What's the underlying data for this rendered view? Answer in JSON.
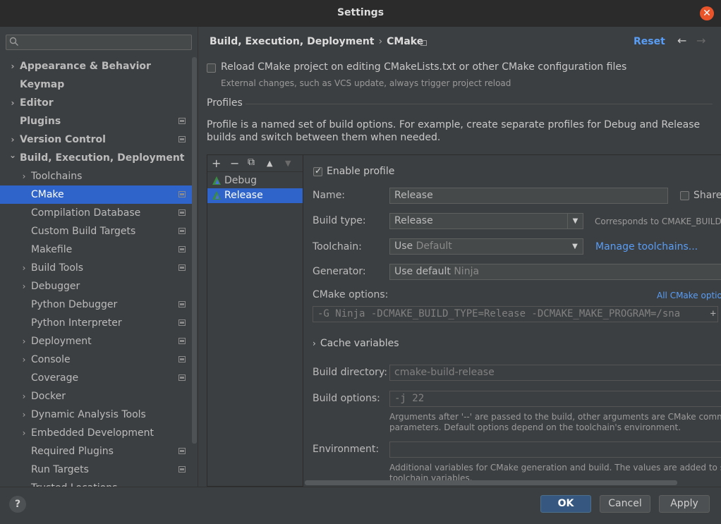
{
  "window": {
    "title": "Settings"
  },
  "sidebar": {
    "search_placeholder": "",
    "items": [
      {
        "label": "Appearance & Behavior",
        "bold": true,
        "chevron": true,
        "indent": 0,
        "proj": false
      },
      {
        "label": "Keymap",
        "bold": true,
        "chevron": false,
        "indent": 0,
        "proj": false
      },
      {
        "label": "Editor",
        "bold": true,
        "chevron": true,
        "indent": 0,
        "proj": false
      },
      {
        "label": "Plugins",
        "bold": true,
        "chevron": false,
        "indent": 0,
        "proj": true
      },
      {
        "label": "Version Control",
        "bold": true,
        "chevron": true,
        "indent": 0,
        "proj": true
      },
      {
        "label": "Build, Execution, Deployment",
        "bold": true,
        "chevron": "open",
        "indent": 0,
        "proj": false
      },
      {
        "label": "Toolchains",
        "bold": false,
        "chevron": true,
        "indent": 1,
        "proj": false
      },
      {
        "label": "CMake",
        "bold": false,
        "chevron": false,
        "indent": 1,
        "proj": true,
        "selected": true
      },
      {
        "label": "Compilation Database",
        "bold": false,
        "chevron": false,
        "indent": 1,
        "proj": true
      },
      {
        "label": "Custom Build Targets",
        "bold": false,
        "chevron": false,
        "indent": 1,
        "proj": true
      },
      {
        "label": "Makefile",
        "bold": false,
        "chevron": false,
        "indent": 1,
        "proj": true
      },
      {
        "label": "Build Tools",
        "bold": false,
        "chevron": true,
        "indent": 1,
        "proj": true
      },
      {
        "label": "Debugger",
        "bold": false,
        "chevron": true,
        "indent": 1,
        "proj": false
      },
      {
        "label": "Python Debugger",
        "bold": false,
        "chevron": false,
        "indent": 1,
        "proj": true
      },
      {
        "label": "Python Interpreter",
        "bold": false,
        "chevron": false,
        "indent": 1,
        "proj": true
      },
      {
        "label": "Deployment",
        "bold": false,
        "chevron": true,
        "indent": 1,
        "proj": true
      },
      {
        "label": "Console",
        "bold": false,
        "chevron": true,
        "indent": 1,
        "proj": true
      },
      {
        "label": "Coverage",
        "bold": false,
        "chevron": false,
        "indent": 1,
        "proj": true
      },
      {
        "label": "Docker",
        "bold": false,
        "chevron": true,
        "indent": 1,
        "proj": false
      },
      {
        "label": "Dynamic Analysis Tools",
        "bold": false,
        "chevron": true,
        "indent": 1,
        "proj": false
      },
      {
        "label": "Embedded Development",
        "bold": false,
        "chevron": true,
        "indent": 1,
        "proj": false
      },
      {
        "label": "Required Plugins",
        "bold": false,
        "chevron": false,
        "indent": 1,
        "proj": true
      },
      {
        "label": "Run Targets",
        "bold": false,
        "chevron": false,
        "indent": 1,
        "proj": true
      },
      {
        "label": "Trusted Locations",
        "bold": false,
        "chevron": false,
        "indent": 1,
        "proj": false
      }
    ]
  },
  "header": {
    "breadcrumb_parent": "Build, Execution, Deployment",
    "breadcrumb_sep": "›",
    "breadcrumb_current": "CMake",
    "reset_label": "Reset",
    "back_glyph": "←",
    "forward_glyph": "→"
  },
  "reload": {
    "label": "Reload CMake project on editing CMakeLists.txt or other CMake configuration files",
    "hint": "External changes, such as VCS update, always trigger project reload",
    "checked": false
  },
  "profiles": {
    "section_title": "Profiles",
    "description_line1": "Profile is a named set of build options. For example, create separate profiles for Debug and Release",
    "description_line2": "builds and switch between them when needed.",
    "toolbar": {
      "add": "+",
      "remove": "−",
      "copy": "⧉",
      "up": "▲",
      "down": "▼"
    },
    "list": [
      {
        "name": "Debug",
        "selected": false
      },
      {
        "name": "Release",
        "selected": true
      }
    ]
  },
  "detail": {
    "enable_label": "Enable profile",
    "enable_checked": true,
    "name_label": "Name:",
    "name_value": "Release",
    "share_label": "Share",
    "build_type_label": "Build type:",
    "build_type_value": "Release",
    "build_type_hint": "Corresponds to CMAKE_BUILD_T",
    "toolchain_label": "Toolchain:",
    "toolchain_prefix": "Use",
    "toolchain_value": "Default",
    "manage_toolchains": "Manage toolchains...",
    "generator_label": "Generator:",
    "generator_prefix": "Use default",
    "generator_value": "Ninja",
    "cmake_options_label": "CMake options:",
    "all_cmake_options": "All CMake option",
    "cmake_options_value": "-G Ninja -DCMAKE_BUILD_TYPE=Release -DCMAKE_MAKE_PROGRAM=/sna",
    "cmake_options_expand": "+",
    "cache_variables_label": "Cache variables",
    "build_dir_label": "Build directory:",
    "build_dir_value": "cmake-build-release",
    "build_options_label": "Build options:",
    "build_options_value": "-j 22",
    "build_options_hint1": "Arguments after '--' are passed to the build, other arguments are CMake command lin",
    "build_options_hint2": "parameters. Default options depend on the toolchain's environment.",
    "environment_label": "Environment:",
    "environment_value": "",
    "env_hint1": "Additional variables for CMake generation and build. The values are added to system a",
    "env_hint2": "toolchain variables."
  },
  "footer": {
    "help": "?",
    "ok": "OK",
    "cancel": "Cancel",
    "apply": "Apply"
  },
  "colors": {
    "selection": "#2f65ca",
    "link": "#589df6",
    "close": "#e9542b"
  }
}
